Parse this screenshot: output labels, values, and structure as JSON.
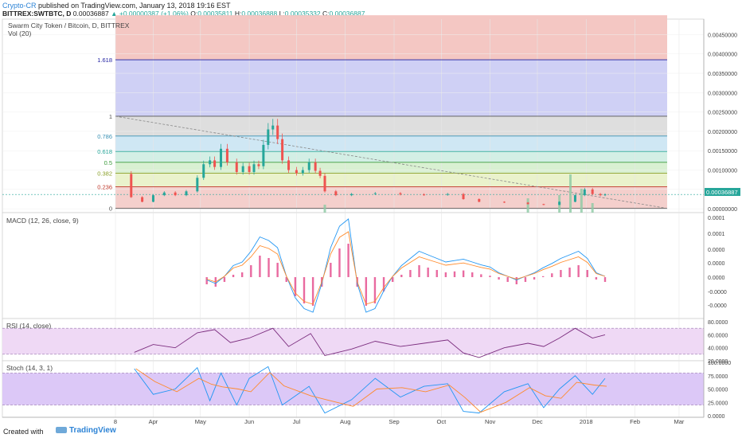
{
  "header": {
    "author": "Crypto-CR",
    "published": "published on TradingView.com, January 13, 2018 19:16 EST",
    "symbol": "BITTREX:SWTBTC, D",
    "last": "0.00036887",
    "change": "▲ +0.00000387 (+1.06%)",
    "o_label": "O:",
    "o": "0.00035811",
    "h_label": "H:",
    "h": "0.00036888",
    "l_label": "L:",
    "l": "0.00035332",
    "c_label": "C:",
    "c": "0.00036887"
  },
  "main_pane": {
    "title": "Swarm City Token / Bitcoin, D, BITTREX",
    "vol_label": "Vol (20)",
    "price_tag": "0.00036887",
    "price_tag_color": "#26a69a"
  },
  "fib": {
    "levels": [
      {
        "label": "1.618",
        "price": 0.00385,
        "color": "#1e1ea0"
      },
      {
        "label": "1",
        "price": 0.00239,
        "color": "#555555"
      },
      {
        "label": "0.786",
        "price": 0.00188,
        "color": "#3a91b4"
      },
      {
        "label": "0.618",
        "price": 0.00148,
        "color": "#26a69a"
      },
      {
        "label": "0.5",
        "price": 0.0012,
        "color": "#3a9a3a"
      },
      {
        "label": "0.382",
        "price": 0.00092,
        "color": "#8aa02a"
      },
      {
        "label": "0.236",
        "price": 0.00057,
        "color": "#c0392b"
      },
      {
        "label": "0",
        "price": 1e-05,
        "color": "#555555"
      }
    ],
    "bands": [
      {
        "from": 0.00385,
        "to": 0.005,
        "color": "#f4c7c3"
      },
      {
        "from": 0.00239,
        "to": 0.00385,
        "color": "#cfd0f5"
      },
      {
        "from": 0.00188,
        "to": 0.00239,
        "color": "#dedede"
      },
      {
        "from": 0.00148,
        "to": 0.00188,
        "color": "#cfe7f4"
      },
      {
        "from": 0.0012,
        "to": 0.00148,
        "color": "#d3efe5"
      },
      {
        "from": 0.00092,
        "to": 0.0012,
        "color": "#d9f0d2"
      },
      {
        "from": 0.00057,
        "to": 0.00092,
        "color": "#eaf2cc"
      },
      {
        "from": 1e-05,
        "to": 0.00057,
        "color": "#f4cfcc"
      }
    ]
  },
  "panes": {
    "macd_label": "MACD (12, 26, close, 9)",
    "rsi_label": "RSI (14, close)",
    "stoch_label": "Stoch (14, 3, 1)"
  },
  "chart_data": {
    "type": "candlestick",
    "price_axis": {
      "range": [
        -0.0001,
        0.0049
      ],
      "ticks": [
        "0.00450000",
        "0.00400000",
        "0.00350000",
        "0.00300000",
        "0.00250000",
        "0.00200000",
        "0.00150000",
        "0.00100000",
        "0.00050000",
        "0.00000000"
      ]
    },
    "time_axis": {
      "ticks": [
        "8",
        "Apr",
        "May",
        "Jun",
        "Jul",
        "Aug",
        "Sep",
        "Oct",
        "Nov",
        "Dec",
        "2018",
        "Feb",
        "Mar"
      ]
    },
    "close_series": [
      [
        "2017-03-14",
        0.0009
      ],
      [
        "2017-03-18",
        0.0003
      ],
      [
        "2017-03-25",
        0.00018
      ],
      [
        "2017-04-01",
        0.00035
      ],
      [
        "2017-04-08",
        0.00042
      ],
      [
        "2017-04-15",
        0.00035
      ],
      [
        "2017-04-22",
        0.00045
      ],
      [
        "2017-04-29",
        0.0008
      ],
      [
        "2017-05-03",
        0.00115
      ],
      [
        "2017-05-07",
        0.00125
      ],
      [
        "2017-05-10",
        0.00108
      ],
      [
        "2017-05-14",
        0.00155
      ],
      [
        "2017-05-18",
        0.0012
      ],
      [
        "2017-05-24",
        0.00095
      ],
      [
        "2017-05-28",
        0.0011
      ],
      [
        "2017-06-01",
        0.00095
      ],
      [
        "2017-06-04",
        0.00115
      ],
      [
        "2017-06-07",
        0.0011
      ],
      [
        "2017-06-10",
        0.00165
      ],
      [
        "2017-06-13",
        0.00205
      ],
      [
        "2017-06-16",
        0.00215
      ],
      [
        "2017-06-19",
        0.0018
      ],
      [
        "2017-06-22",
        0.00125
      ],
      [
        "2017-06-26",
        0.001
      ],
      [
        "2017-07-01",
        0.00092
      ],
      [
        "2017-07-05",
        0.001
      ],
      [
        "2017-07-09",
        0.0012
      ],
      [
        "2017-07-13",
        0.00098
      ],
      [
        "2017-07-16",
        0.00085
      ],
      [
        "2017-07-19",
        0.00045
      ],
      [
        "2017-07-26",
        0.00035
      ],
      [
        "2017-08-05",
        0.00038
      ],
      [
        "2017-08-20",
        0.0004
      ],
      [
        "2017-09-05",
        0.00037
      ],
      [
        "2017-09-20",
        0.00036
      ],
      [
        "2017-10-05",
        0.00038
      ],
      [
        "2017-10-15",
        0.00025
      ],
      [
        "2017-10-25",
        0.00018
      ],
      [
        "2017-11-10",
        0.00016
      ],
      [
        "2017-11-25",
        0.00012
      ],
      [
        "2017-12-05",
        0.0001
      ],
      [
        "2017-12-15",
        0.00018
      ],
      [
        "2017-12-25",
        0.00035
      ],
      [
        "2017-12-31",
        0.0005
      ],
      [
        "2018-01-05",
        0.00038
      ],
      [
        "2018-01-10",
        0.00035
      ],
      [
        "2018-01-13",
        0.00036887
      ]
    ],
    "macd_axis": {
      "ticks": [
        "0.0001",
        "0.0001",
        "0.0000",
        "0.0000",
        "0.0000",
        "-0.0000",
        "-0.0000"
      ]
    },
    "rsi_axis": {
      "ticks": [
        "80.0000",
        "60.0000",
        "40.0000",
        "20.0000"
      ],
      "bands": [
        70,
        30
      ]
    },
    "rsi_series": [
      [
        "2017-03-20",
        33
      ],
      [
        "2017-04-01",
        45
      ],
      [
        "2017-04-15",
        40
      ],
      [
        "2017-04-29",
        63
      ],
      [
        "2017-05-10",
        68
      ],
      [
        "2017-05-20",
        48
      ],
      [
        "2017-06-01",
        55
      ],
      [
        "2017-06-16",
        70
      ],
      [
        "2017-06-26",
        42
      ],
      [
        "2017-07-10",
        62
      ],
      [
        "2017-07-19",
        28
      ],
      [
        "2017-08-05",
        38
      ],
      [
        "2017-08-20",
        50
      ],
      [
        "2017-09-05",
        42
      ],
      [
        "2017-09-20",
        47
      ],
      [
        "2017-10-05",
        52
      ],
      [
        "2017-10-15",
        32
      ],
      [
        "2017-10-25",
        25
      ],
      [
        "2017-11-10",
        40
      ],
      [
        "2017-11-25",
        47
      ],
      [
        "2017-12-05",
        42
      ],
      [
        "2017-12-15",
        55
      ],
      [
        "2017-12-25",
        70
      ],
      [
        "2018-01-05",
        55
      ],
      [
        "2018-01-13",
        60
      ]
    ],
    "stoch_axis": {
      "ticks": [
        "100.0000",
        "75.0000",
        "50.0000",
        "25.0000",
        "0.0000"
      ],
      "bands": [
        80,
        20
      ]
    },
    "stoch_series": [
      [
        "2017-03-20",
        88
      ],
      [
        "2017-04-01",
        40
      ],
      [
        "2017-04-15",
        50
      ],
      [
        "2017-04-29",
        90
      ],
      [
        "2017-05-07",
        28
      ],
      [
        "2017-05-14",
        80
      ],
      [
        "2017-05-24",
        20
      ],
      [
        "2017-06-01",
        70
      ],
      [
        "2017-06-13",
        92
      ],
      [
        "2017-06-22",
        20
      ],
      [
        "2017-07-09",
        55
      ],
      [
        "2017-07-19",
        5
      ],
      [
        "2017-08-05",
        30
      ],
      [
        "2017-08-20",
        70
      ],
      [
        "2017-09-05",
        35
      ],
      [
        "2017-09-20",
        55
      ],
      [
        "2017-10-05",
        60
      ],
      [
        "2017-10-15",
        8
      ],
      [
        "2017-10-25",
        5
      ],
      [
        "2017-11-10",
        45
      ],
      [
        "2017-11-25",
        60
      ],
      [
        "2017-12-05",
        15
      ],
      [
        "2017-12-15",
        50
      ],
      [
        "2017-12-25",
        75
      ],
      [
        "2018-01-05",
        40
      ],
      [
        "2018-01-13",
        70
      ]
    ]
  },
  "footer": {
    "created_with": "Created with",
    "brand": "TradingView"
  }
}
